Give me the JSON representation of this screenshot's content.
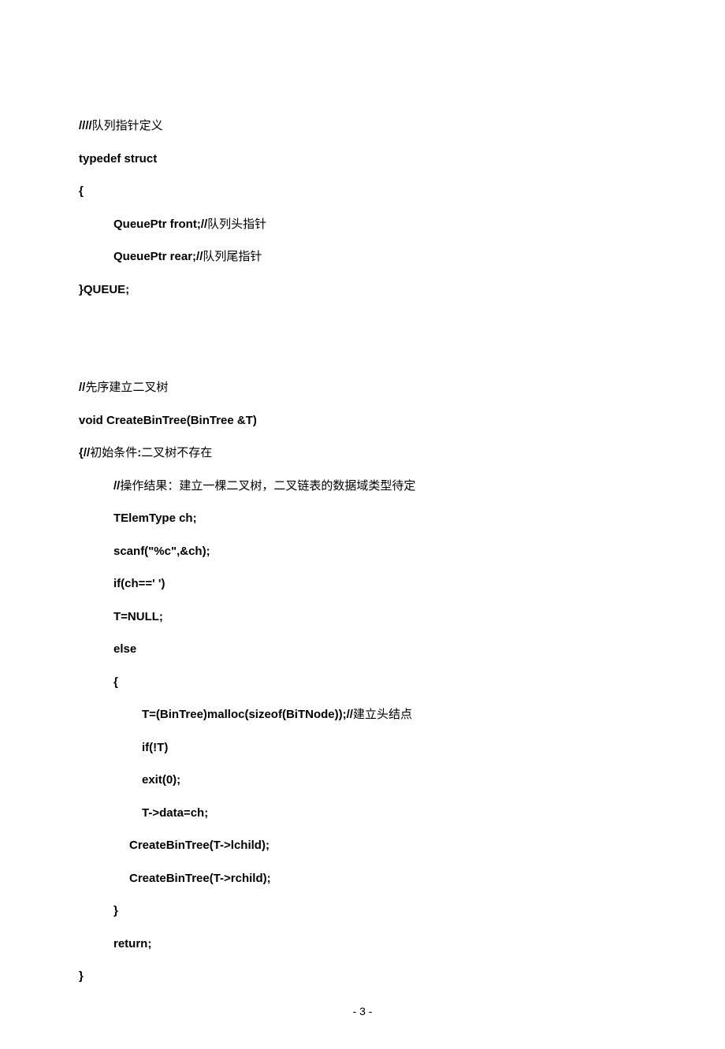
{
  "lines": [
    {
      "cls": "",
      "parts": [
        {
          "b": true,
          "t": "////"
        },
        {
          "b": false,
          "t": "队列指针定义"
        }
      ]
    },
    {
      "cls": "",
      "parts": [
        {
          "b": true,
          "t": "typedef struct"
        }
      ]
    },
    {
      "cls": "",
      "parts": [
        {
          "b": true,
          "t": "{"
        }
      ]
    },
    {
      "cls": "indent1",
      "parts": [
        {
          "b": true,
          "t": "QueuePtr front;//"
        },
        {
          "b": false,
          "t": "队列头指针"
        }
      ]
    },
    {
      "cls": "indent1",
      "parts": [
        {
          "b": true,
          "t": "QueuePtr rear;//"
        },
        {
          "b": false,
          "t": "队列尾指针"
        }
      ]
    },
    {
      "cls": "",
      "parts": [
        {
          "b": true,
          "t": "}QUEUE;"
        }
      ]
    },
    {
      "cls": "",
      "parts": [
        {
          "b": false,
          "t": " "
        }
      ]
    },
    {
      "cls": "",
      "parts": [
        {
          "b": false,
          "t": " "
        }
      ]
    },
    {
      "cls": "",
      "parts": [
        {
          "b": true,
          "t": "//"
        },
        {
          "b": false,
          "t": "先序建立二叉树"
        }
      ]
    },
    {
      "cls": "",
      "parts": [
        {
          "b": true,
          "t": "void CreateBinTree(BinTree &T)"
        }
      ]
    },
    {
      "cls": "",
      "parts": [
        {
          "b": true,
          "t": "{//"
        },
        {
          "b": false,
          "t": "初始条件"
        },
        {
          "b": true,
          "t": ":"
        },
        {
          "b": false,
          "t": "二叉树不存在"
        }
      ]
    },
    {
      "cls": "indent1",
      "parts": [
        {
          "b": true,
          "t": "//"
        },
        {
          "b": false,
          "t": "操作结果：建立一棵二叉树，二叉链表的数据域类型待定"
        }
      ]
    },
    {
      "cls": "indent1",
      "parts": [
        {
          "b": true,
          "t": "TElemType ch;"
        }
      ]
    },
    {
      "cls": "indent1",
      "parts": [
        {
          "b": true,
          "t": "scanf(\"%c\",&ch);"
        }
      ]
    },
    {
      "cls": "indent1",
      "parts": [
        {
          "b": true,
          "t": "if(ch==' ')"
        }
      ]
    },
    {
      "cls": "indent1",
      "parts": [
        {
          "b": true,
          "t": "T=NULL;"
        }
      ]
    },
    {
      "cls": "indent1",
      "parts": [
        {
          "b": true,
          "t": "else"
        }
      ]
    },
    {
      "cls": "indent1",
      "parts": [
        {
          "b": true,
          "t": "{"
        }
      ]
    },
    {
      "cls": "indent2",
      "parts": [
        {
          "b": true,
          "t": "T=(BinTree)malloc(sizeof(BiTNode));//"
        },
        {
          "b": false,
          "t": "建立头结点"
        }
      ]
    },
    {
      "cls": "indent2",
      "parts": [
        {
          "b": true,
          "t": "if(!T)"
        }
      ]
    },
    {
      "cls": "indent2",
      "parts": [
        {
          "b": true,
          "t": "exit(0);"
        }
      ]
    },
    {
      "cls": "indent2",
      "parts": [
        {
          "b": true,
          "t": "T->data=ch;"
        }
      ]
    },
    {
      "cls": "indent2b",
      "parts": [
        {
          "b": true,
          "t": "CreateBinTree(T->lchild);"
        }
      ]
    },
    {
      "cls": "indent2b",
      "parts": [
        {
          "b": true,
          "t": "CreateBinTree(T->rchild);"
        }
      ]
    },
    {
      "cls": "indent1",
      "parts": [
        {
          "b": true,
          "t": "}"
        }
      ]
    },
    {
      "cls": "indent1",
      "parts": [
        {
          "b": true,
          "t": "return;"
        }
      ]
    },
    {
      "cls": "",
      "parts": [
        {
          "b": true,
          "t": "}"
        }
      ]
    }
  ],
  "footer": "- 3 -"
}
